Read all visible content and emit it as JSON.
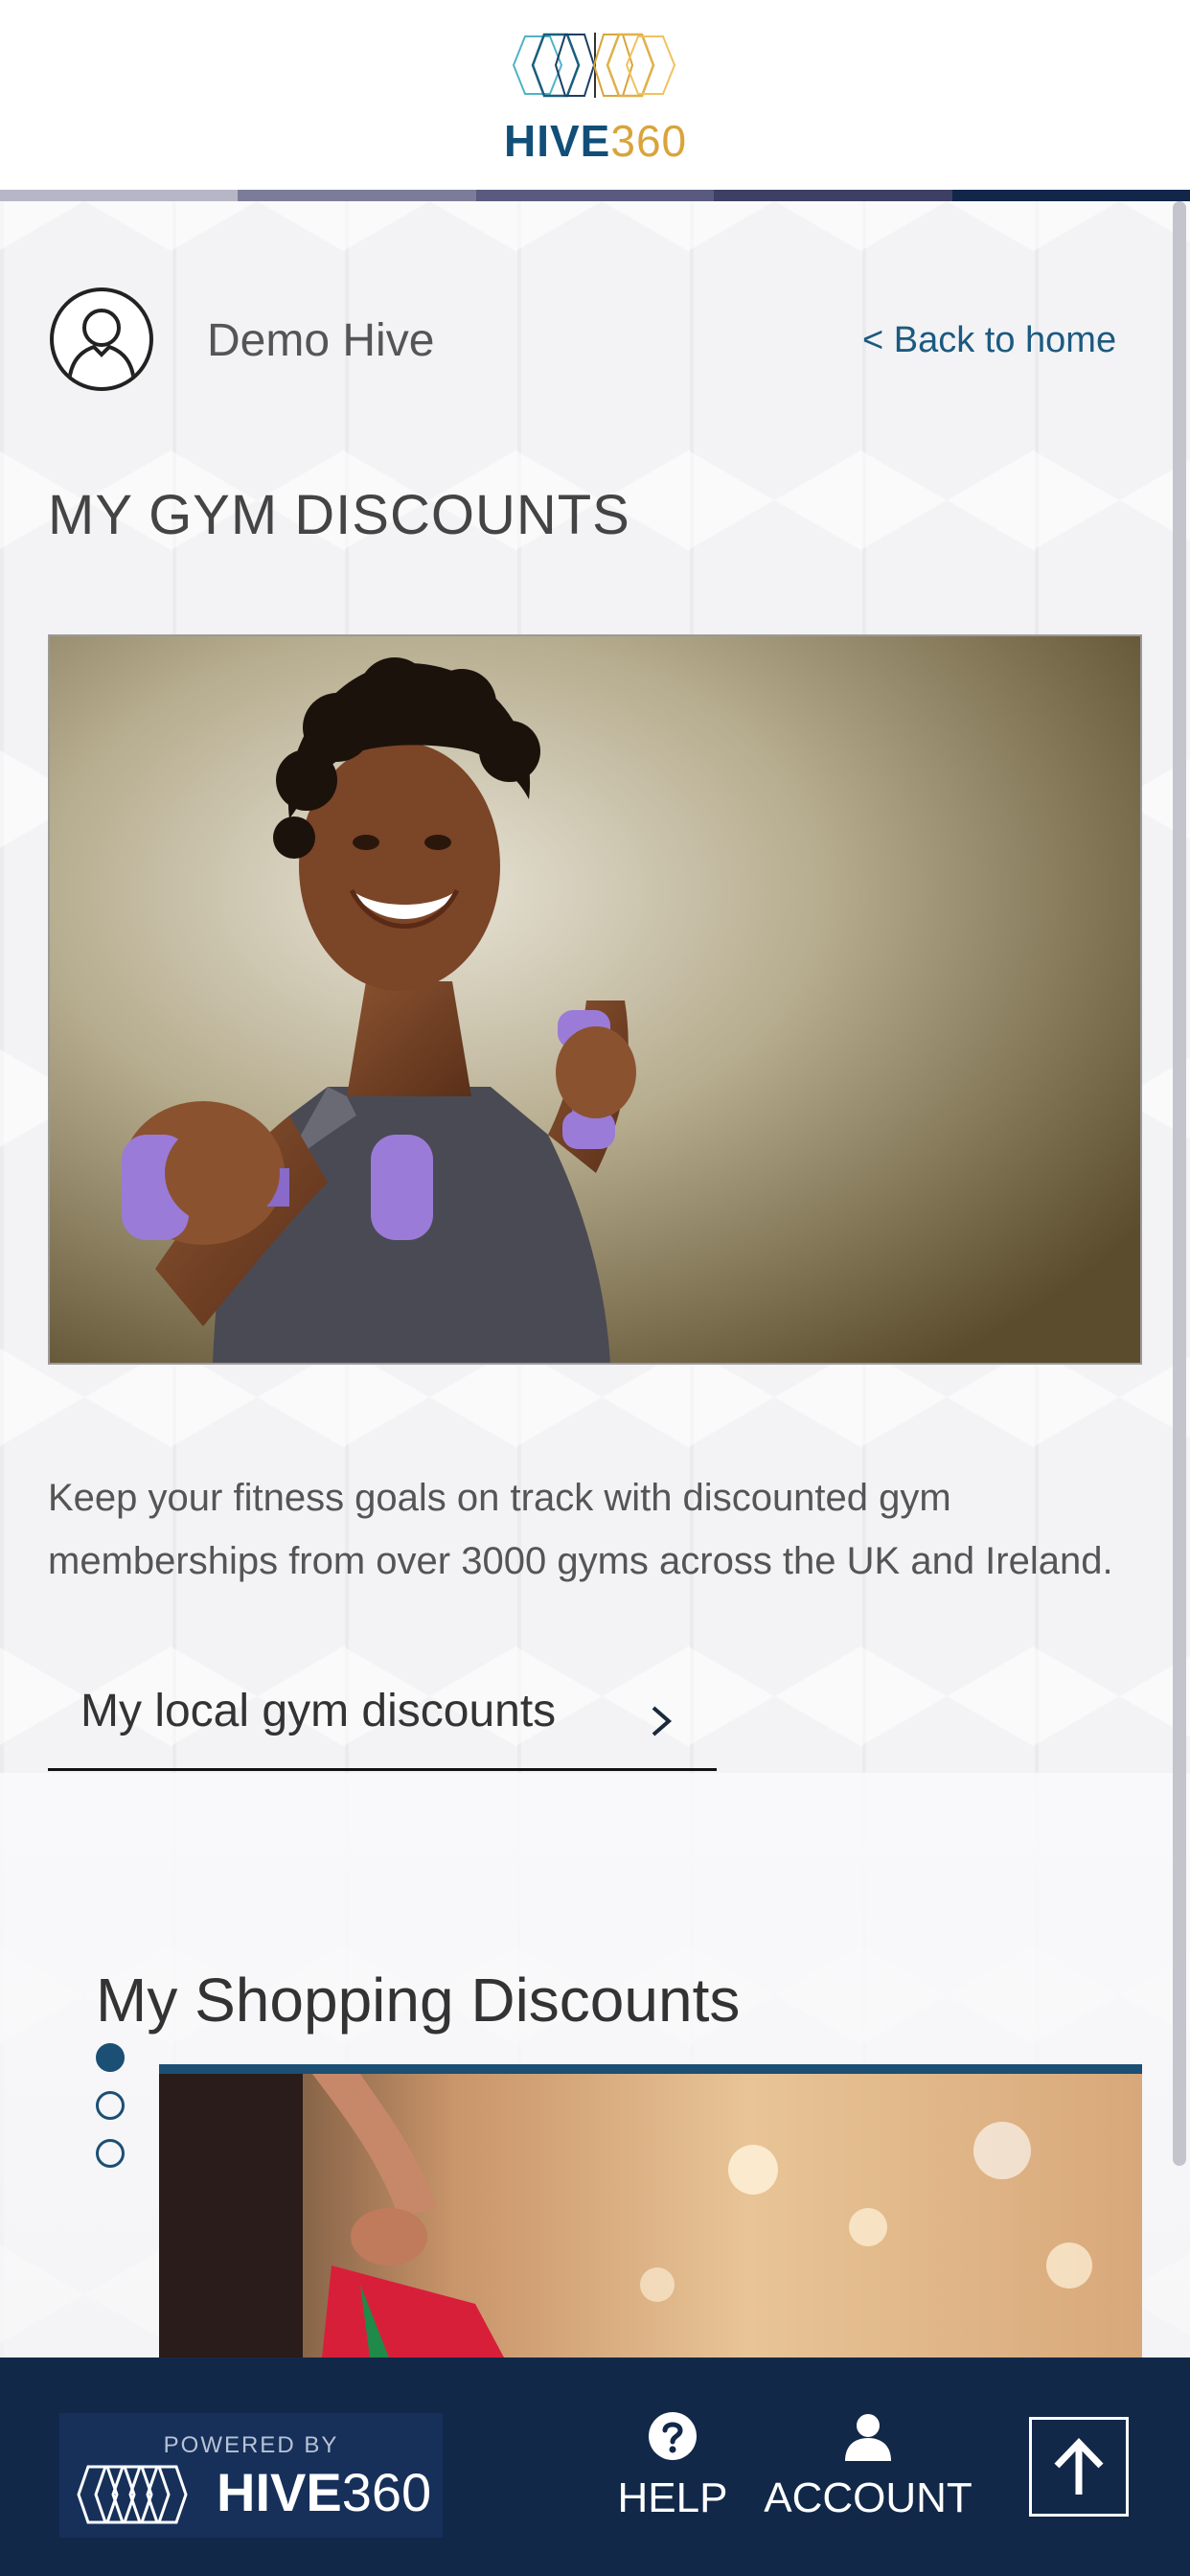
{
  "header": {
    "logo": {
      "brand": "HIVE",
      "number": "360",
      "colors": {
        "blue": "#114f78",
        "gold": "#d9a43a"
      }
    }
  },
  "profile": {
    "name": "Demo Hive",
    "back_link": "< Back to home",
    "avatar_icon": "user-outline-icon"
  },
  "page": {
    "title": "MY GYM DISCOUNTS",
    "hero_alt": "woman-with-dumbbells-photo",
    "description": "Keep your fitness goals on track with discounted gym memberships from over 3000 gyms across the UK and Ireland.",
    "gym_link": {
      "label": "My local gym discounts",
      "icon": "chevron-right-icon"
    }
  },
  "shopping": {
    "title": "My Shopping Discounts",
    "carousel_dots": 3,
    "active_dot": 1,
    "image": "shopping-bags-photo"
  },
  "footer": {
    "powered_by": "POWERED BY",
    "brand": "HIVE",
    "brand_number": "360",
    "help_label": "HELP",
    "account_label": "ACCOUNT",
    "help_icon": "question-circle-icon",
    "account_icon": "person-icon",
    "top_icon": "arrow-up-icon",
    "background": "#122849"
  }
}
